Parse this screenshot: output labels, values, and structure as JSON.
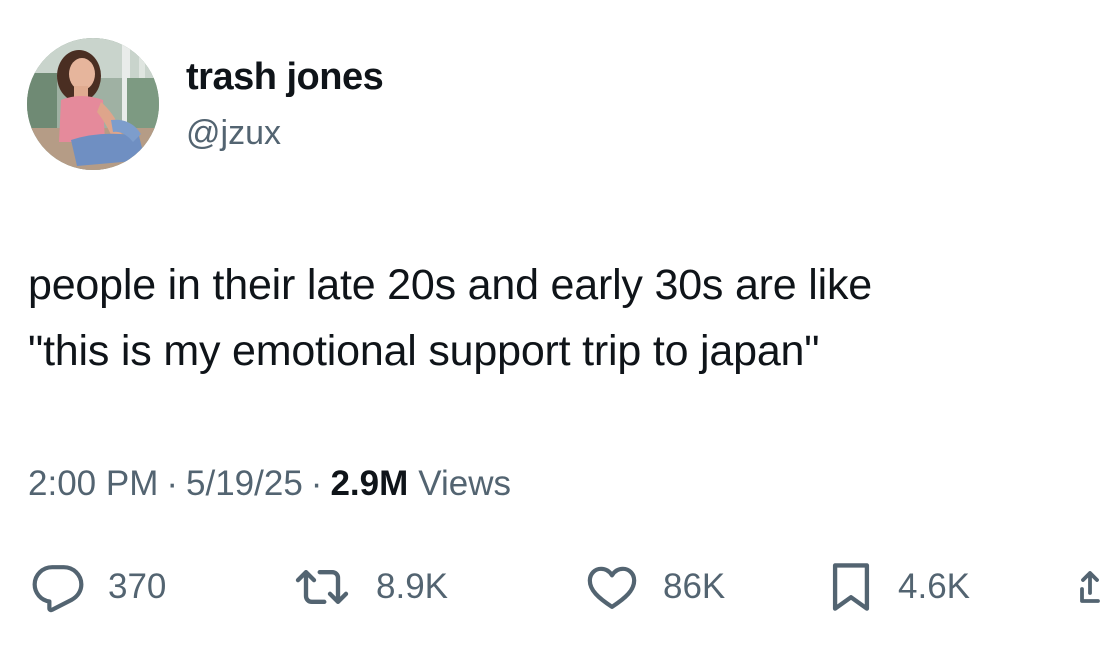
{
  "author": {
    "display_name": "trash jones",
    "handle": "@jzux"
  },
  "tweet": {
    "text": "people in their late 20s and early 30s are like\n\"this is my emotional support trip to japan\""
  },
  "meta": {
    "time": "2:00 PM",
    "separator": "·",
    "date": "5/19/25",
    "views_count": "2.9M",
    "views_label": "Views"
  },
  "actions": {
    "reply": {
      "icon": "reply-icon",
      "count": "370"
    },
    "repost": {
      "icon": "repost-icon",
      "count": "8.9K"
    },
    "like": {
      "icon": "heart-icon",
      "count": "86K"
    },
    "bookmark": {
      "icon": "bookmark-icon",
      "count": "4.6K"
    },
    "share": {
      "icon": "share-icon"
    }
  },
  "colors": {
    "text_primary": "#0f1419",
    "text_secondary": "#536471",
    "background": "#ffffff"
  }
}
